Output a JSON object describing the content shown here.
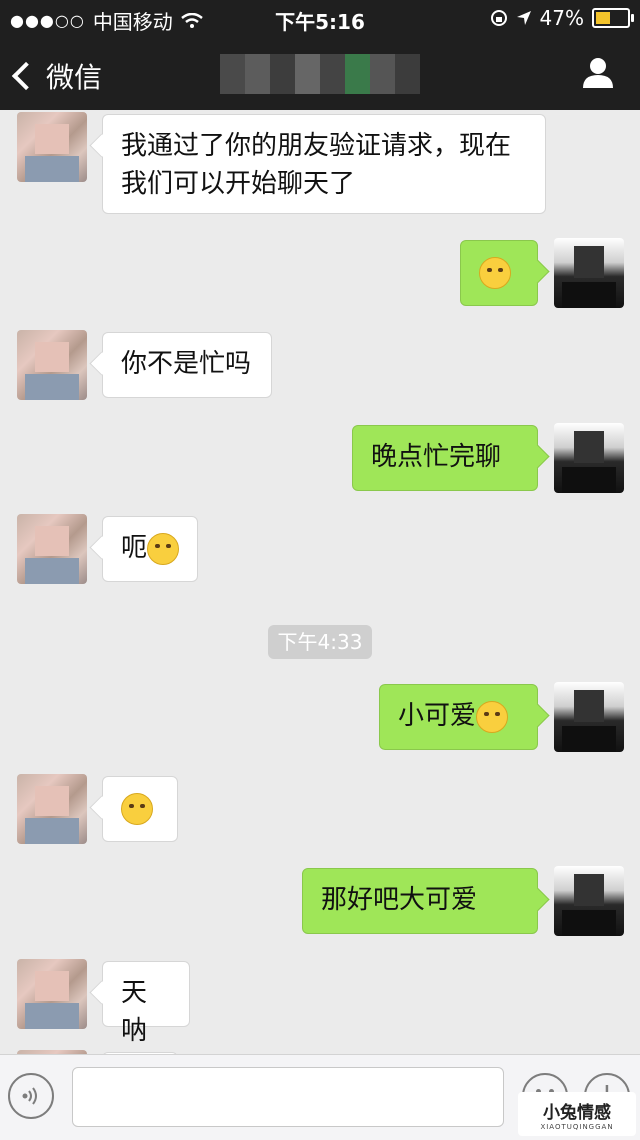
{
  "status_bar": {
    "signal": "●●●○○",
    "carrier": "中国移动",
    "time": "下午5:16",
    "battery": "47%",
    "battery_level": 0.47
  },
  "nav": {
    "back_label": "微信"
  },
  "messages": [
    {
      "side": "left",
      "text": "我通过了你的朋友验证请求，现在我们可以开始聊天了"
    },
    {
      "side": "right",
      "text": "",
      "emoji": "smirk-emoji"
    },
    {
      "side": "left",
      "text": "你不是忙吗"
    },
    {
      "side": "right",
      "text": "晚点忙完聊"
    },
    {
      "side": "left",
      "text": "呃",
      "emoji": "smile-emoji"
    },
    {
      "side": "right",
      "text": "小可爱",
      "emoji": "smirk-emoji"
    },
    {
      "side": "left",
      "text": "",
      "emoji": "blush-emoji"
    },
    {
      "side": "right",
      "text": "那好吧大可爱"
    },
    {
      "side": "left",
      "text": "天呐"
    }
  ],
  "timestamp": "下午4:33",
  "watermark": {
    "title": "小兔情感",
    "subtitle": "XIAOTUQINGGAN"
  }
}
